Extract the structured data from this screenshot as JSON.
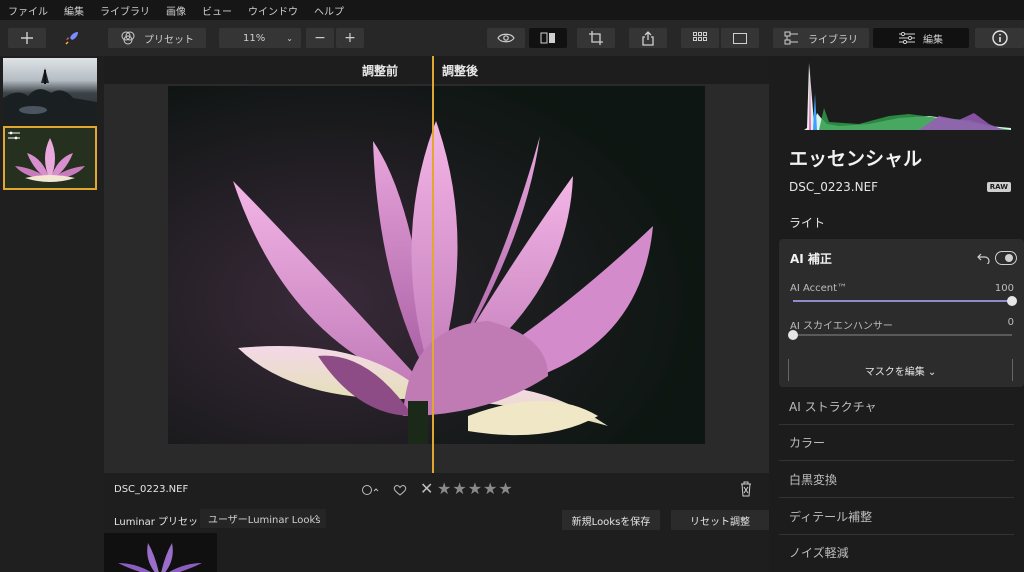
{
  "menu": {
    "items": [
      "ファイル",
      "編集",
      "ライブラリ",
      "画像",
      "ビュー",
      "ウインドウ",
      "ヘルプ"
    ]
  },
  "toolbar": {
    "add_icon": "plus-icon",
    "rocket_icon": "rocket-icon",
    "preset_label": "プリセット",
    "zoom_value": "11%",
    "zoom_out_label": "−",
    "zoom_in_label": "+",
    "library_label": "ライブラリ",
    "edit_label": "編集"
  },
  "compare": {
    "before_label": "調整前",
    "after_label": "調整後"
  },
  "bottom": {
    "filename": "DSC_0223.NEF",
    "stars": "★★★★★",
    "reject": "✕"
  },
  "presets": {
    "label": "Luminar プリセット",
    "dropdown": "ユーザーLuminar Looks",
    "save_looks": "新規Looksを保存",
    "reset": "リセット調整"
  },
  "panel": {
    "title": "エッセンシャル",
    "filename": "DSC_0223.NEF",
    "raw_badge": "RAW",
    "light": "ライト",
    "ai": {
      "title": "AI 補正",
      "accent_label": "AI Accent™",
      "accent_value": "100",
      "accent_fraction": 1.0,
      "sky_label": "AI スカイエンハンサー",
      "sky_value": "0",
      "sky_fraction": 0,
      "mask_button": "マスクを編集 ⌄"
    },
    "tools": [
      "AI ストラクチャ",
      "カラー",
      "白黒変換",
      "ディテール補整",
      "ノイズ軽減"
    ]
  },
  "colors": {
    "accent": "#e0a830",
    "slider_fill": "#8d8ec9"
  }
}
